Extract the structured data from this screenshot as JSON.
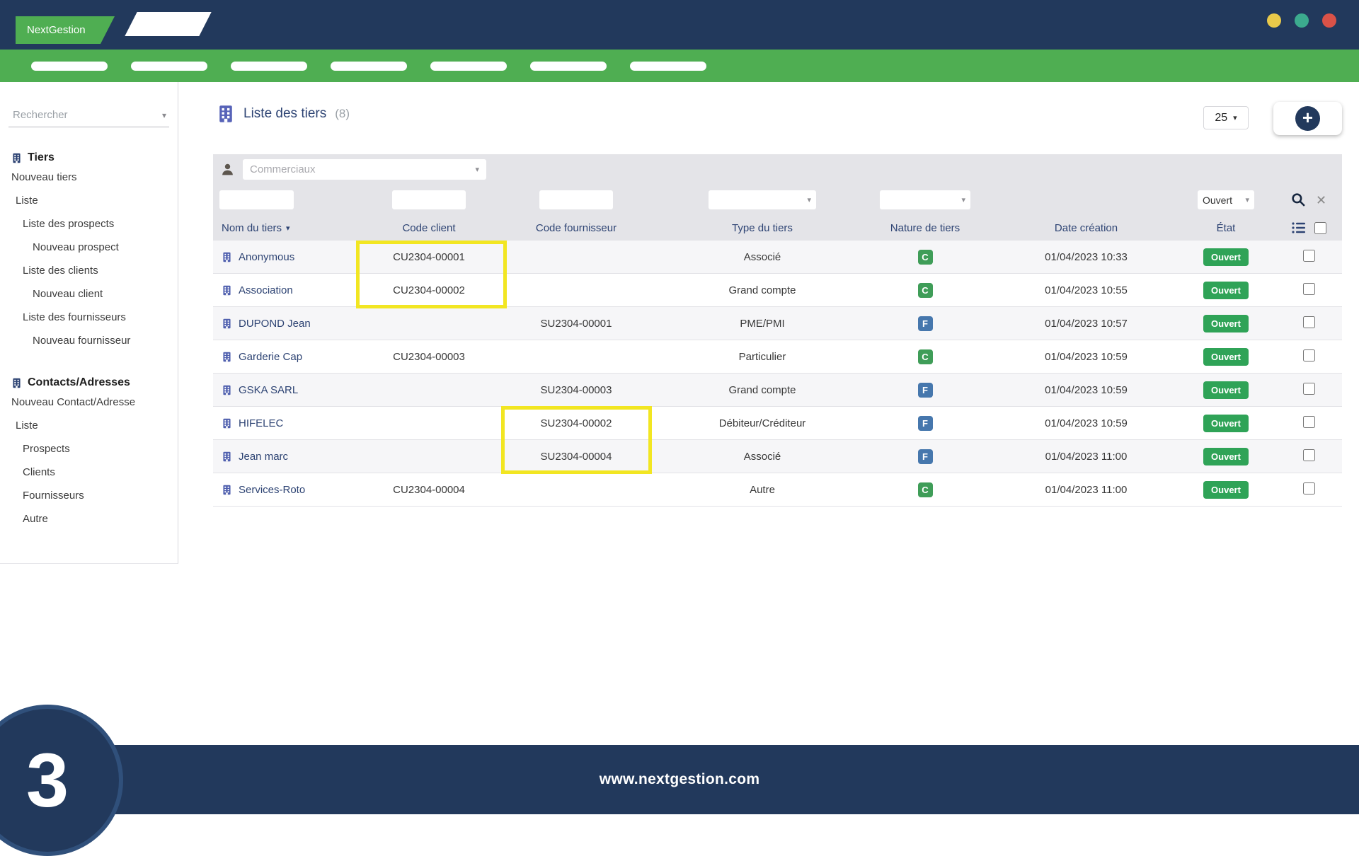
{
  "window": {
    "brand": "NextGestion"
  },
  "menu": {
    "pill_count": 7
  },
  "icons": {
    "caret_down": "▾",
    "sort_desc": "▾",
    "close": "✕",
    "plus": "+"
  },
  "sidebar": {
    "search_placeholder": "Rechercher",
    "sections": [
      {
        "title": "Tiers",
        "items": [
          {
            "label": "Nouveau tiers",
            "indent": 0
          },
          {
            "label": "Liste",
            "indent": 1
          },
          {
            "label": "Liste des prospects",
            "indent": 2
          },
          {
            "label": "Nouveau prospect",
            "indent": 3
          },
          {
            "label": "Liste des clients",
            "indent": 2
          },
          {
            "label": "Nouveau client",
            "indent": 3
          },
          {
            "label": "Liste des fournisseurs",
            "indent": 2
          },
          {
            "label": "Nouveau fournisseur",
            "indent": 3
          }
        ]
      },
      {
        "title": "Contacts/Adresses",
        "items": [
          {
            "label": "Nouveau Contact/Adresse",
            "indent": 0
          },
          {
            "label": "Liste",
            "indent": 1
          },
          {
            "label": "Prospects",
            "indent": 2
          },
          {
            "label": "Clients",
            "indent": 2
          },
          {
            "label": "Fournisseurs",
            "indent": 2
          },
          {
            "label": "Autre",
            "indent": 2
          }
        ]
      }
    ]
  },
  "main": {
    "title": "Liste des tiers",
    "count": "(8)",
    "page_size": "25",
    "filters": {
      "commerciaux_placeholder": "Commerciaux",
      "etat_value": "Ouvert"
    },
    "columns": [
      "Nom du tiers",
      "Code client",
      "Code fournisseur",
      "Type du tiers",
      "Nature de tiers",
      "Date création",
      "État"
    ],
    "rows": [
      {
        "name": "Anonymous",
        "code_client": "CU2304-00001",
        "code_fournisseur": "",
        "type": "Associé",
        "nature": "C",
        "date": "01/04/2023 10:33",
        "etat": "Ouvert"
      },
      {
        "name": "Association",
        "code_client": "CU2304-00002",
        "code_fournisseur": "",
        "type": "Grand compte",
        "nature": "C",
        "date": "01/04/2023 10:55",
        "etat": "Ouvert"
      },
      {
        "name": "DUPOND Jean",
        "code_client": "",
        "code_fournisseur": "SU2304-00001",
        "type": "PME/PMI",
        "nature": "F",
        "date": "01/04/2023 10:57",
        "etat": "Ouvert"
      },
      {
        "name": "Garderie Cap",
        "code_client": "CU2304-00003",
        "code_fournisseur": "",
        "type": "Particulier",
        "nature": "C",
        "date": "01/04/2023 10:59",
        "etat": "Ouvert"
      },
      {
        "name": "GSKA SARL",
        "code_client": "",
        "code_fournisseur": "SU2304-00003",
        "type": "Grand compte",
        "nature": "F",
        "date": "01/04/2023 10:59",
        "etat": "Ouvert"
      },
      {
        "name": "HIFELEC",
        "code_client": "",
        "code_fournisseur": "SU2304-00002",
        "type": "Débiteur/Créditeur",
        "nature": "F",
        "date": "01/04/2023 10:59",
        "etat": "Ouvert"
      },
      {
        "name": "Jean marc",
        "code_client": "",
        "code_fournisseur": "SU2304-00004",
        "type": "Associé",
        "nature": "F",
        "date": "01/04/2023 11:00",
        "etat": "Ouvert"
      },
      {
        "name": "Services-Roto",
        "code_client": "CU2304-00004",
        "code_fournisseur": "",
        "type": "Autre",
        "nature": "C",
        "date": "01/04/2023 11:00",
        "etat": "Ouvert"
      }
    ]
  },
  "colors": {
    "navy": "#22395c",
    "brand_green": "#4fae52",
    "badge_client": "#3f9d58",
    "badge_fournisseur": "#4677ad",
    "status_open": "#2fa357",
    "highlight_yellow": "#f2e622"
  },
  "footer": {
    "url": "www.nextgestion.com",
    "slide_number": "3"
  }
}
